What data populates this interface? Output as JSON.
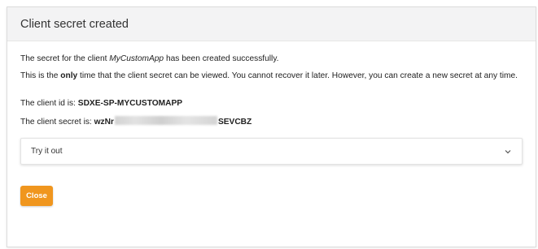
{
  "dialog": {
    "title": "Client secret created",
    "message1": {
      "prefix": "The secret for the client ",
      "client_name": "MyCustomApp",
      "suffix": " has been created successfully."
    },
    "message2": {
      "prefix": "This is the ",
      "emphasis": "only",
      "suffix": " time that the client secret can be viewed. You cannot recover it later. However, you can create a new secret at any time."
    },
    "client_id": {
      "label": "The client id is: ",
      "value": "SDXE-SP-MYCUSTOMAPP"
    },
    "client_secret": {
      "label": "The client secret is: ",
      "value_start": "wzNr",
      "value_end": "SEVCBZ"
    },
    "try_it_out": {
      "label": "Try it out",
      "icon": "chevron-down-icon",
      "expanded": false
    },
    "close_label": "Close"
  },
  "colors": {
    "header_bg": "#f3f3f4",
    "close_button": "#f0961e"
  }
}
